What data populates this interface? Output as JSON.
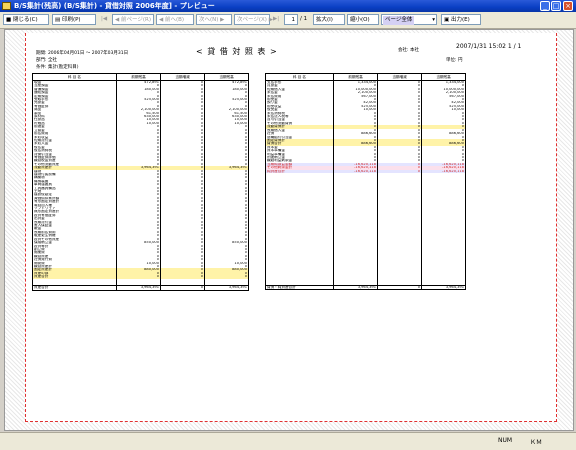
{
  "window": {
    "title": "B/S集計(残高)  (B/S集計) - 貸借対照  2006年度]  - プレビュー"
  },
  "toolbar": {
    "close_label": "閉じる(C)",
    "print_label": "印刷(P)",
    "first_label": "|◀",
    "prev_page_label": "◀ 前ページ(R)",
    "prev_label": "◀ 前へ(B)",
    "next_label": "次へ(N) ▶",
    "next_page_label": "次ページ(X) ▶",
    "last_label": "▶|",
    "page_value": "1",
    "page_total": "/ 1",
    "zoom_in_label": "拡大(I)",
    "zoom_out_label": "縮小(O)",
    "zoom_value": "ページ全体",
    "export_label": "出力(E)"
  },
  "report": {
    "period": "期間: 2006年04月01日 ～ 2007年03月31日",
    "dept": "部門: 全社",
    "filter": "条件: 集計(勘定科目)",
    "title": "< 貸 借 対 照 表 >",
    "company_label": "会社: 本社",
    "date": "2007/1/31 15:02  1 / 1",
    "unit_label": "単位: 円",
    "columns": [
      "科 目 名",
      "前期残高",
      "当期増減",
      "当期残高"
    ],
    "left_rows": [
      [
        "現金",
        "472,891",
        "0",
        "472,891"
      ],
      [
        "当座預金",
        "0",
        "0",
        "0"
      ],
      [
        "普通預金",
        "180,000",
        "0",
        "180,000"
      ],
      [
        "通知預金",
        "0",
        "0",
        "0"
      ],
      [
        "定期預金",
        "0",
        "0",
        "0"
      ],
      [
        "受取手形",
        "525,000",
        "0",
        "525,000"
      ],
      [
        "売掛金",
        "0",
        "0",
        "0"
      ],
      [
        "有価証券",
        "0",
        "0",
        "0"
      ],
      [
        "商品",
        "2,100,000",
        "0",
        "2,100,000"
      ],
      [
        "製品",
        "61,500",
        "0",
        "61,500"
      ],
      [
        "原材料",
        "630,000",
        "0",
        "630,000"
      ],
      [
        "仕掛品",
        "10,000",
        "0",
        "10,000"
      ],
      [
        "貯蔵品",
        "10,000",
        "0",
        "10,000"
      ],
      [
        "前渡金",
        "0",
        "0",
        "0"
      ],
      [
        "立替金",
        "0",
        "0",
        "0"
      ],
      [
        "前払費用",
        "0",
        "0",
        "0"
      ],
      [
        "未収収益",
        "0",
        "0",
        "0"
      ],
      [
        "短期貸付金",
        "0",
        "0",
        "0"
      ],
      [
        "未収入金",
        "0",
        "0",
        "0"
      ],
      [
        "仮払金",
        "0",
        "0",
        "0"
      ],
      [
        "仮払消費税",
        "0",
        "0",
        "0"
      ],
      [
        "貸倒引当金",
        "0",
        "0",
        "0"
      ],
      [
        "有価証券評価",
        "0",
        "0",
        "0"
      ],
      [
        "繰延税金資産",
        "0",
        "0",
        "0"
      ],
      [
        "その他流動資産",
        "0",
        "0",
        "0"
      ],
      [
        "流動資産計",
        "3,964,391",
        "0",
        "3,964,391"
      ],
      [
        "建物",
        "0",
        "0",
        "0"
      ],
      [
        "建物付属設備",
        "0",
        "0",
        "0"
      ],
      [
        "構築物",
        "0",
        "0",
        "0"
      ],
      [
        "機械装置",
        "0",
        "0",
        "0"
      ],
      [
        "車両運搬具",
        "0",
        "0",
        "0"
      ],
      [
        "工具器具備品",
        "0",
        "0",
        "0"
      ],
      [
        "土地",
        "0",
        "0",
        "0"
      ],
      [
        "建設仮勘定",
        "0",
        "0",
        "0"
      ],
      [
        "減価償却累計額",
        "0",
        "0",
        "0"
      ],
      [
        "有形固定資産計",
        "0",
        "0",
        "0"
      ],
      [
        "電話加入権",
        "0",
        "0",
        "0"
      ],
      [
        "ソフトウェア",
        "0",
        "0",
        "0"
      ],
      [
        "無形固定資産計",
        "0",
        "0",
        "0"
      ],
      [
        "投資有価証券",
        "0",
        "0",
        "0"
      ],
      [
        "出資金",
        "0",
        "0",
        "0"
      ],
      [
        "長期貸付金",
        "0",
        "0",
        "0"
      ],
      [
        "差入保証金",
        "0",
        "0",
        "0"
      ],
      [
        "敷金",
        "0",
        "0",
        "0"
      ],
      [
        "長期前払費用",
        "0",
        "0",
        "0"
      ],
      [
        "破産更生債権",
        "0",
        "0",
        "0"
      ],
      [
        "投資その他資産",
        "0",
        "0",
        "0"
      ],
      [
        "保険積立金",
        "850,000",
        "0",
        "850,000"
      ],
      [
        "投資等計",
        "0",
        "0",
        "0"
      ],
      [
        "創立費",
        "0",
        "0",
        "0"
      ],
      [
        "開業費",
        "0",
        "0",
        "0"
      ],
      [
        "繰延資産",
        "0",
        "0",
        "0"
      ],
      [
        "社債発行費",
        "0",
        "0",
        "0"
      ],
      [
        "開発費",
        "10,000",
        "0",
        "10,000"
      ],
      [
        "繰延資産計",
        "0",
        "0",
        "0"
      ],
      [
        "固定資産計",
        "880,000",
        "0",
        "880,000"
      ],
      [
        "資産の部",
        "0",
        "0",
        "0"
      ],
      [
        "資産合計",
        "0",
        "0",
        "0"
      ]
    ],
    "right_rows": [
      [
        "支払手形",
        "1,334,000",
        "0",
        "1,334,000"
      ],
      [
        "買掛金",
        "0",
        "0",
        "0"
      ],
      [
        "短期借入金",
        "10,000,000",
        "0",
        "10,000,000"
      ],
      [
        "未払金",
        "2,100,000",
        "0",
        "2,100,000"
      ],
      [
        "未払費用",
        "567,000",
        "0",
        "567,000"
      ],
      [
        "前受金",
        "0",
        "0",
        "0"
      ],
      [
        "預り金",
        "42,000",
        "0",
        "42,000"
      ],
      [
        "前受収益",
        "525,000",
        "0",
        "525,000"
      ],
      [
        "仮受金",
        "10,000",
        "0",
        "10,000"
      ],
      [
        "未払消費税",
        "0",
        "0",
        "0"
      ],
      [
        "未払法人税等",
        "0",
        "0",
        "0"
      ],
      [
        "賞与引当金",
        "0",
        "0",
        "0"
      ],
      [
        "その他流動負債",
        "0",
        "0",
        "0"
      ],
      [
        "流動負債計",
        "0",
        "0",
        "0"
      ],
      [
        "長期借入金",
        "0",
        "0",
        "0"
      ],
      [
        "社債",
        "886,600",
        "0",
        "886,600"
      ],
      [
        "退職給付引当金",
        "0",
        "0",
        "0"
      ],
      [
        "固定負債計",
        "0",
        "0",
        "0"
      ],
      [
        "負債合計",
        "886,600",
        "0",
        "886,600"
      ],
      [
        "資本金",
        "0",
        "0",
        "0"
      ],
      [
        "資本準備金",
        "0",
        "0",
        "0"
      ],
      [
        "利益準備金",
        "0",
        "0",
        "0"
      ],
      [
        "別途積立金",
        "0",
        "0",
        "0"
      ],
      [
        "繰越利益剰余金",
        "0",
        "0",
        "0"
      ],
      [
        "当期純損益金額",
        "-16,620,118",
        "0",
        "-16,620,118"
      ],
      [
        "その他剰余金計",
        "-16,620,118",
        "0",
        "-16,620,118"
      ],
      [
        "純資産合計",
        "-16,620,118",
        "0",
        "-16,620,118"
      ]
    ],
    "left_total": [
      "資産合計",
      "3,964,391",
      "0",
      "3,964,391"
    ],
    "right_total": [
      "負債・純資産合計",
      "3,964,391",
      "0",
      "3,964,391"
    ]
  },
  "status": {
    "left": "",
    "num": "NUM",
    "cap": "ＫＭ"
  }
}
